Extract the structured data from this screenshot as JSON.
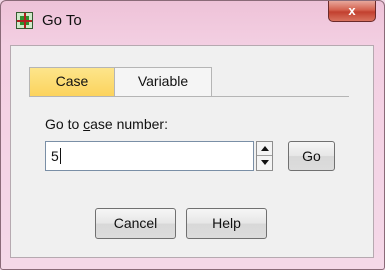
{
  "window": {
    "title": "Go To",
    "close_label": "x"
  },
  "tabs": [
    {
      "label": "Case",
      "selected": true
    },
    {
      "label": "Variable",
      "selected": false
    }
  ],
  "case_number": {
    "label_prefix": "Go to ",
    "label_mnemonic": "c",
    "label_rest": "ase number:",
    "value": "5"
  },
  "buttons": {
    "go": "Go",
    "cancel": "Cancel",
    "help": "Help"
  },
  "icons": {
    "app": "spss-data-icon",
    "spin_up": "spin-up-icon",
    "spin_down": "spin-down-icon"
  },
  "colors": {
    "selected_tab": "#fcd35d",
    "close_button": "#c2402f",
    "titlebar": "#eec2d8"
  }
}
